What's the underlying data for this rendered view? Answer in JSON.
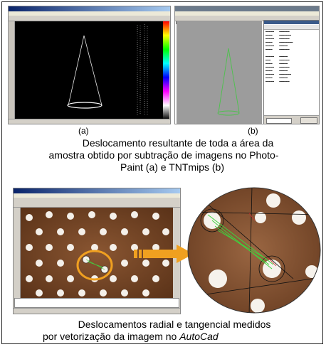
{
  "panel_a": {
    "label": "(a)"
  },
  "panel_b": {
    "label": "(b)"
  },
  "caption_top": {
    "line1": "Deslocamento resultante de toda a área da",
    "line2": "amostra obtido por subtração de imagens no Photo-",
    "line3": "Paint (a) e TNTmips (b)"
  },
  "caption_bottom": {
    "line1": "Deslocamentos radial e tangencial medidos",
    "line2_prefix": "por vetorização da imagem no ",
    "line2_app": "AutoCad"
  },
  "colors": {
    "arrow": "#f0a020",
    "highlight_ring": "#f0a020",
    "cone_a": "#e8e8e8",
    "cone_b": "#4cc24c",
    "vector_green": "#3fd23f"
  }
}
